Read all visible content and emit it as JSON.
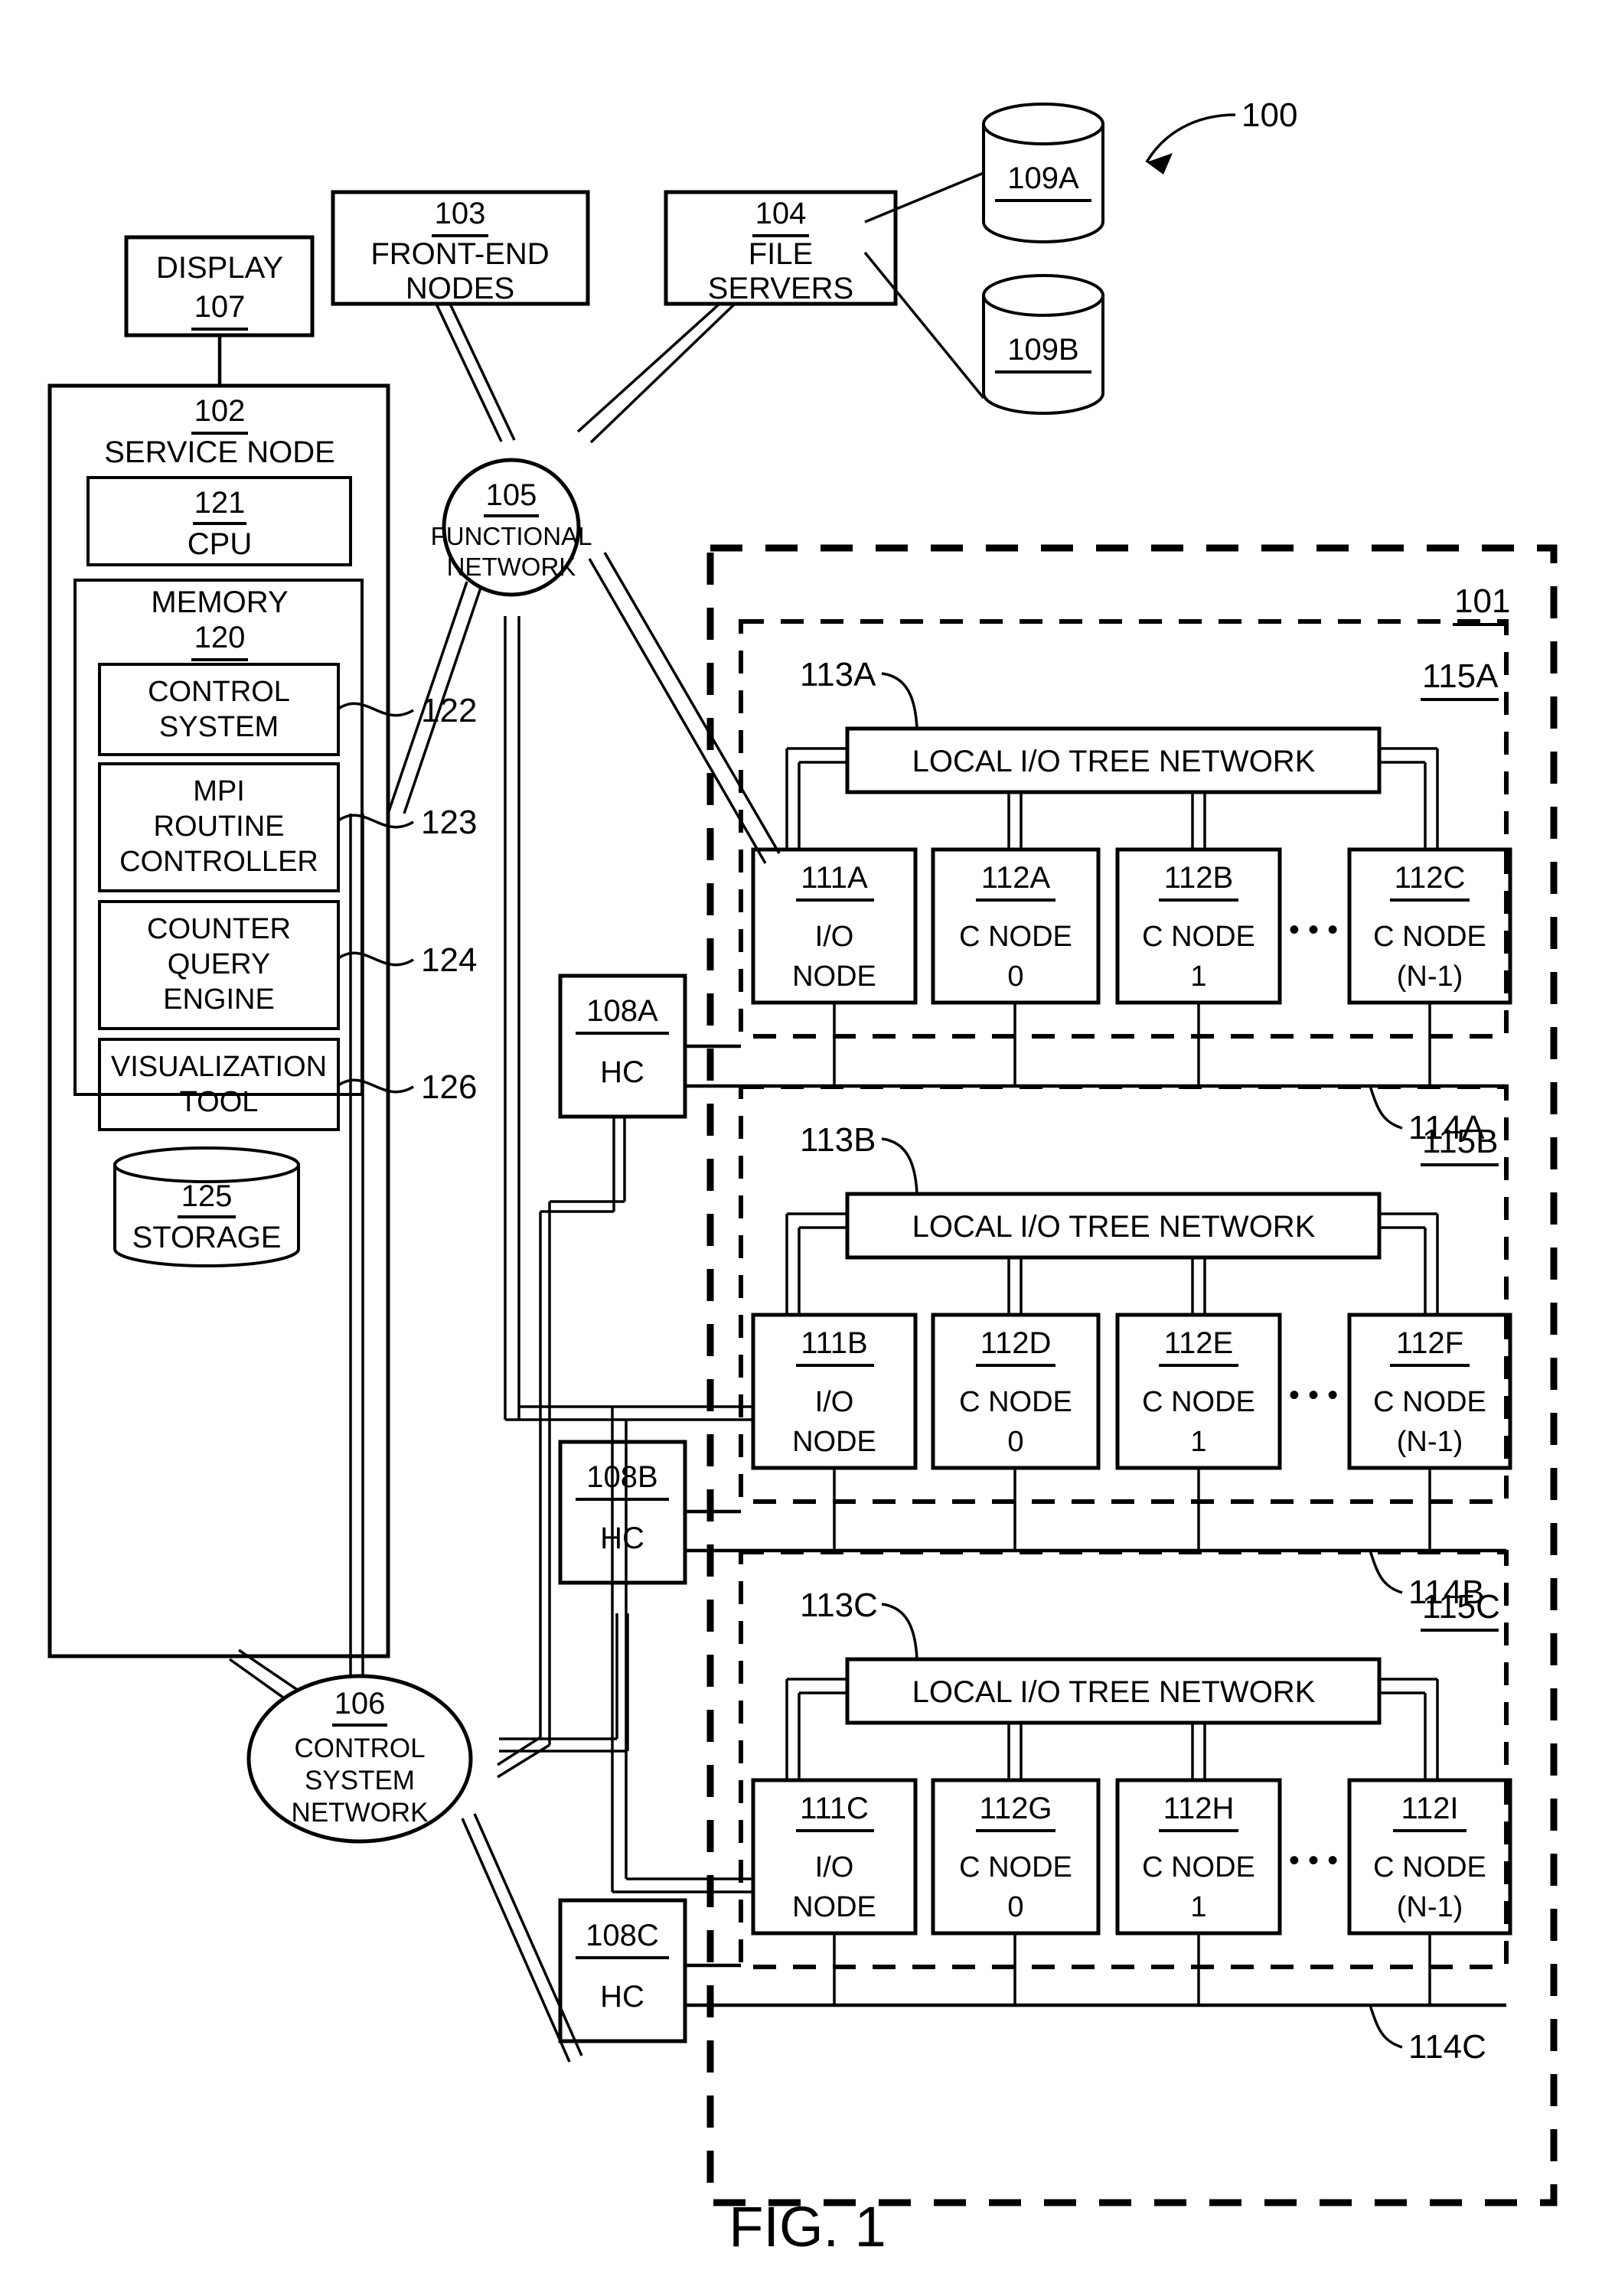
{
  "figure": {
    "caption": "FIG. 1",
    "system_ref": "100"
  },
  "boxes": {
    "display": {
      "ref": "107",
      "label": "DISPLAY"
    },
    "front_end": {
      "ref": "103",
      "label_line1": "FRONT-END",
      "label_line2": "NODES"
    },
    "file_servers": {
      "ref": "104",
      "label_line1": "FILE",
      "label_line2": "SERVERS"
    },
    "service_node": {
      "ref": "102",
      "label": "SERVICE NODE"
    },
    "cpu": {
      "ref": "121",
      "label": "CPU"
    },
    "memory": {
      "ref": "120",
      "label": "MEMORY"
    },
    "control_system": {
      "ref": "122",
      "label_line1": "CONTROL",
      "label_line2": "SYSTEM"
    },
    "mpi_routine_controller": {
      "ref": "123",
      "label_line1": "MPI",
      "label_line2": "ROUTINE",
      "label_line3": "CONTROLLER"
    },
    "counter_query_engine": {
      "ref": "124",
      "label_line1": "COUNTER",
      "label_line2": "QUERY",
      "label_line3": "ENGINE"
    },
    "visualization_tool": {
      "ref": "126",
      "label_line1": "VISUALIZATION",
      "label_line2": "TOOL"
    },
    "storage": {
      "ref": "125",
      "label": "STORAGE"
    }
  },
  "disks": [
    {
      "ref": "109A"
    },
    {
      "ref": "109B"
    }
  ],
  "networks": {
    "functional": {
      "ref": "105",
      "label_line1": "FUNCTIONAL",
      "label_line2": "NETWORK"
    },
    "control_system": {
      "ref": "106",
      "label_line1": "CONTROL",
      "label_line2": "SYSTEM",
      "label_line3": "NETWORK"
    }
  },
  "hardware_controllers": [
    {
      "ref": "108A",
      "label": "HC"
    },
    {
      "ref": "108B",
      "label": "HC"
    },
    {
      "ref": "108C",
      "label": "HC"
    }
  ],
  "compute_core": {
    "ref": "101"
  },
  "node_groups": [
    {
      "ref": "115A",
      "tree_network": {
        "ref": "113A",
        "label": "LOCAL I/O TREE NETWORK"
      },
      "bus": {
        "ref": "114A"
      },
      "ellipsis": "• • •",
      "nodes": [
        {
          "ref": "111A",
          "line1": "I/O",
          "line2": "NODE"
        },
        {
          "ref": "112A",
          "line1": "C NODE",
          "line2": "0"
        },
        {
          "ref": "112B",
          "line1": "C NODE",
          "line2": "1"
        },
        {
          "ref": "112C",
          "line1": "C NODE",
          "line2": "(N-1)"
        }
      ]
    },
    {
      "ref": "115B",
      "tree_network": {
        "ref": "113B",
        "label": "LOCAL I/O TREE NETWORK"
      },
      "bus": {
        "ref": "114B"
      },
      "ellipsis": "• • •",
      "nodes": [
        {
          "ref": "111B",
          "line1": "I/O",
          "line2": "NODE"
        },
        {
          "ref": "112D",
          "line1": "C NODE",
          "line2": "0"
        },
        {
          "ref": "112E",
          "line1": "C NODE",
          "line2": "1"
        },
        {
          "ref": "112F",
          "line1": "C NODE",
          "line2": "(N-1)"
        }
      ]
    },
    {
      "ref": "115C",
      "tree_network": {
        "ref": "113C",
        "label": "LOCAL I/O TREE NETWORK"
      },
      "bus": {
        "ref": "114C"
      },
      "ellipsis": "• • •",
      "nodes": [
        {
          "ref": "111C",
          "line1": "I/O",
          "line2": "NODE"
        },
        {
          "ref": "112G",
          "line1": "C NODE",
          "line2": "0"
        },
        {
          "ref": "112H",
          "line1": "C NODE",
          "line2": "1"
        },
        {
          "ref": "112I",
          "line1": "C NODE",
          "line2": "(N-1)"
        }
      ]
    }
  ],
  "colors": {
    "ink": "#000000",
    "paper": "#ffffff"
  }
}
